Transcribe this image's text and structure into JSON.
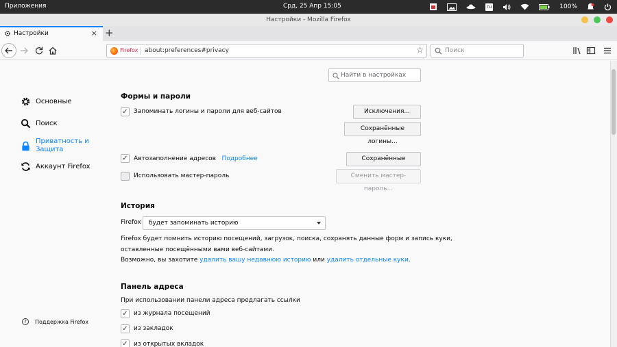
{
  "system": {
    "apps_label": "Приложения",
    "clock": "Срд, 25 Апр   15:05",
    "lang": "ru",
    "battery": "100%"
  },
  "window": {
    "title": "Настройки - Mozilla Firefox"
  },
  "tab": {
    "label": "Настройки"
  },
  "urlbar": {
    "identity": "Firefox",
    "url": "about:preferences#privacy"
  },
  "searchbar": {
    "placeholder": "Поиск"
  },
  "find": {
    "placeholder": "Найти в настройках"
  },
  "sidebar": {
    "items": [
      {
        "label": "Основные",
        "icon": "gear-icon"
      },
      {
        "label": "Поиск",
        "icon": "search-icon"
      },
      {
        "label": "Приватность и Защита",
        "line1": "Приватность и",
        "line2": "Защита",
        "icon": "lock-icon",
        "active": true
      },
      {
        "label": "Аккаунт Firefox",
        "icon": "sync-icon"
      }
    ],
    "support": "Поддержка Firefox"
  },
  "forms": {
    "heading": "Формы и пароли",
    "remember_logins": "Запоминать логины и пароли для веб-сайтов",
    "exceptions_btn": "Исключения...",
    "saved_logins_btn": "Сохранённые логины...",
    "autofill": "Автозаполнение адресов",
    "autofill_more": "Подробнее",
    "saved_addresses_btn": "Сохранённые адреса...",
    "master_password": "Использовать мастер-пароль",
    "change_master_btn": "Сменить мастер-пароль..."
  },
  "history": {
    "heading": "История",
    "label": "Firefox",
    "select_value": "будет запоминать историю",
    "desc1": "Firefox будет помнить историю посещений, загрузок, поиска, сохранять данные форм и запись куки,",
    "desc1_exact": "Firefox будет помнить историю посещений, загрузок, поиска, сохранять данные форм и запись куки,",
    "line1": "Firefox будет помнить историю посещений, загрузок, поиска, сохранять данные форм и запись куки,",
    "line2": "оставленные посещёнными вами веб-сайтами.",
    "maybe": "Возможно, вы захотите",
    "clear_recent": "удалить вашу недавнюю историю",
    "or": "или",
    "remove_cookies": "удалить отдельные куки",
    "period": "."
  },
  "address_bar": {
    "heading": "Панель адреса",
    "subtitle": "При использовании панели адреса предлагать ссылки",
    "opt_history": "из журнала посещений",
    "opt_bookmarks": "из закладок",
    "opt_tabs": "из открытых вкладок"
  }
}
